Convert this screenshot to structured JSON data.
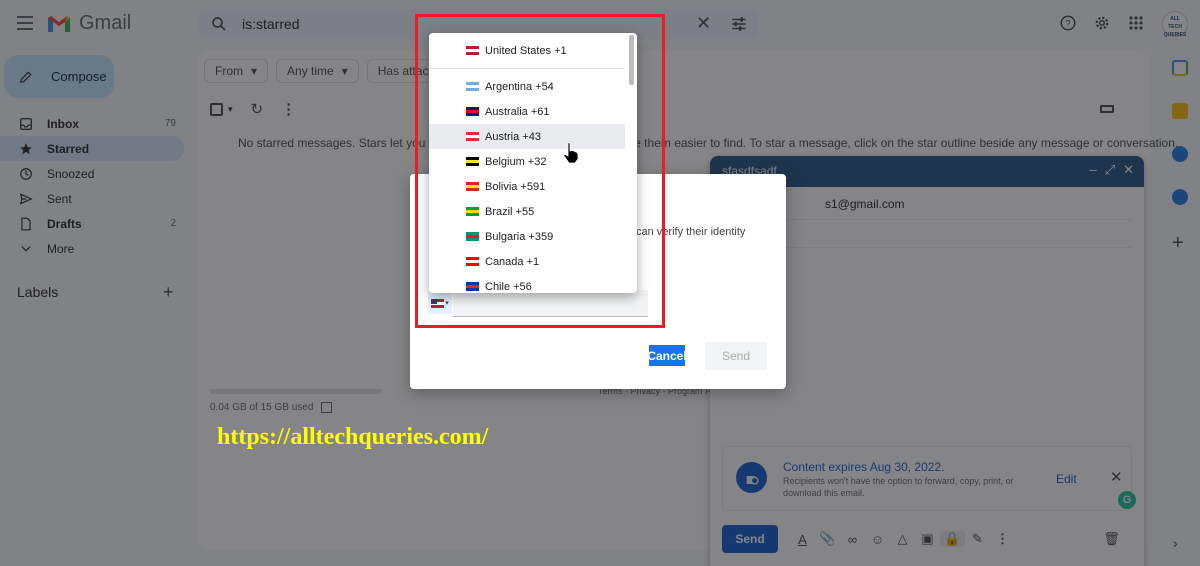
{
  "header": {
    "app_name": "Gmail",
    "search_value": "is:starred",
    "avatar_text": "ALL TECH QUERIES"
  },
  "sidebar": {
    "compose_label": "Compose",
    "items": [
      {
        "label": "Inbox",
        "count": "79",
        "icon": "inbox-icon"
      },
      {
        "label": "Starred",
        "count": "",
        "icon": "star-icon"
      },
      {
        "label": "Snoozed",
        "count": "",
        "icon": "clock-icon"
      },
      {
        "label": "Sent",
        "count": "",
        "icon": "send-icon"
      },
      {
        "label": "Drafts",
        "count": "2",
        "icon": "draft-icon"
      },
      {
        "label": "More",
        "count": "",
        "icon": "chevron-down-icon"
      }
    ],
    "labels_heading": "Labels"
  },
  "main": {
    "filters": [
      "From",
      "Any time",
      "Has attachment"
    ],
    "empty_message": "No starred messages. Stars let you give messages a special status to make them easier to find. To star a message, click on the star outline beside any message or conversation.",
    "storage_text": "0.04 GB of 15 GB used",
    "storage_used_fraction": 0.003,
    "footer_links": "Terms · Privacy · Program Policies"
  },
  "compose_window": {
    "title": "sfasdfsadf",
    "to_value": "s1@gmail.com",
    "confidential": {
      "title": "Content expires Aug 30, 2022.",
      "subtitle": "Recipients won't have the option to forward, copy, print, or download this email.",
      "edit_label": "Edit"
    },
    "send_label": "Send"
  },
  "dialog": {
    "text": "can verify their identity",
    "phone_value": "",
    "cancel_label": "Cancel",
    "send_label": "Send"
  },
  "country_dropdown": {
    "selected": {
      "name": "United States +1",
      "colors": [
        "#b22234",
        "#3c3b6e"
      ]
    },
    "items": [
      {
        "name": "Argentina +54",
        "colors": [
          "#74acdf",
          "#ffffff"
        ]
      },
      {
        "name": "Australia +61",
        "colors": [
          "#012169",
          "#e4002b"
        ]
      },
      {
        "name": "Austria +43",
        "colors": [
          "#ed2939",
          "#ffffff"
        ]
      },
      {
        "name": "Belgium +32",
        "colors": [
          "#000000",
          "#fae042"
        ]
      },
      {
        "name": "Bolivia +591",
        "colors": [
          "#d52b1e",
          "#f9e300"
        ]
      },
      {
        "name": "Brazil +55",
        "colors": [
          "#009c3b",
          "#ffdf00"
        ]
      },
      {
        "name": "Bulgaria +359",
        "colors": [
          "#00966e",
          "#d62612"
        ]
      },
      {
        "name": "Canada +1",
        "colors": [
          "#ff0000",
          "#ffffff"
        ]
      },
      {
        "name": "Chile +56",
        "colors": [
          "#0039a6",
          "#d52b1e"
        ]
      }
    ],
    "hover_index": 2
  },
  "watermark": "https://alltechqueries.com/",
  "colors": {
    "accent": "#0b57d0",
    "highlight_box": "#ed1c24",
    "watermark": "#ffff00"
  }
}
